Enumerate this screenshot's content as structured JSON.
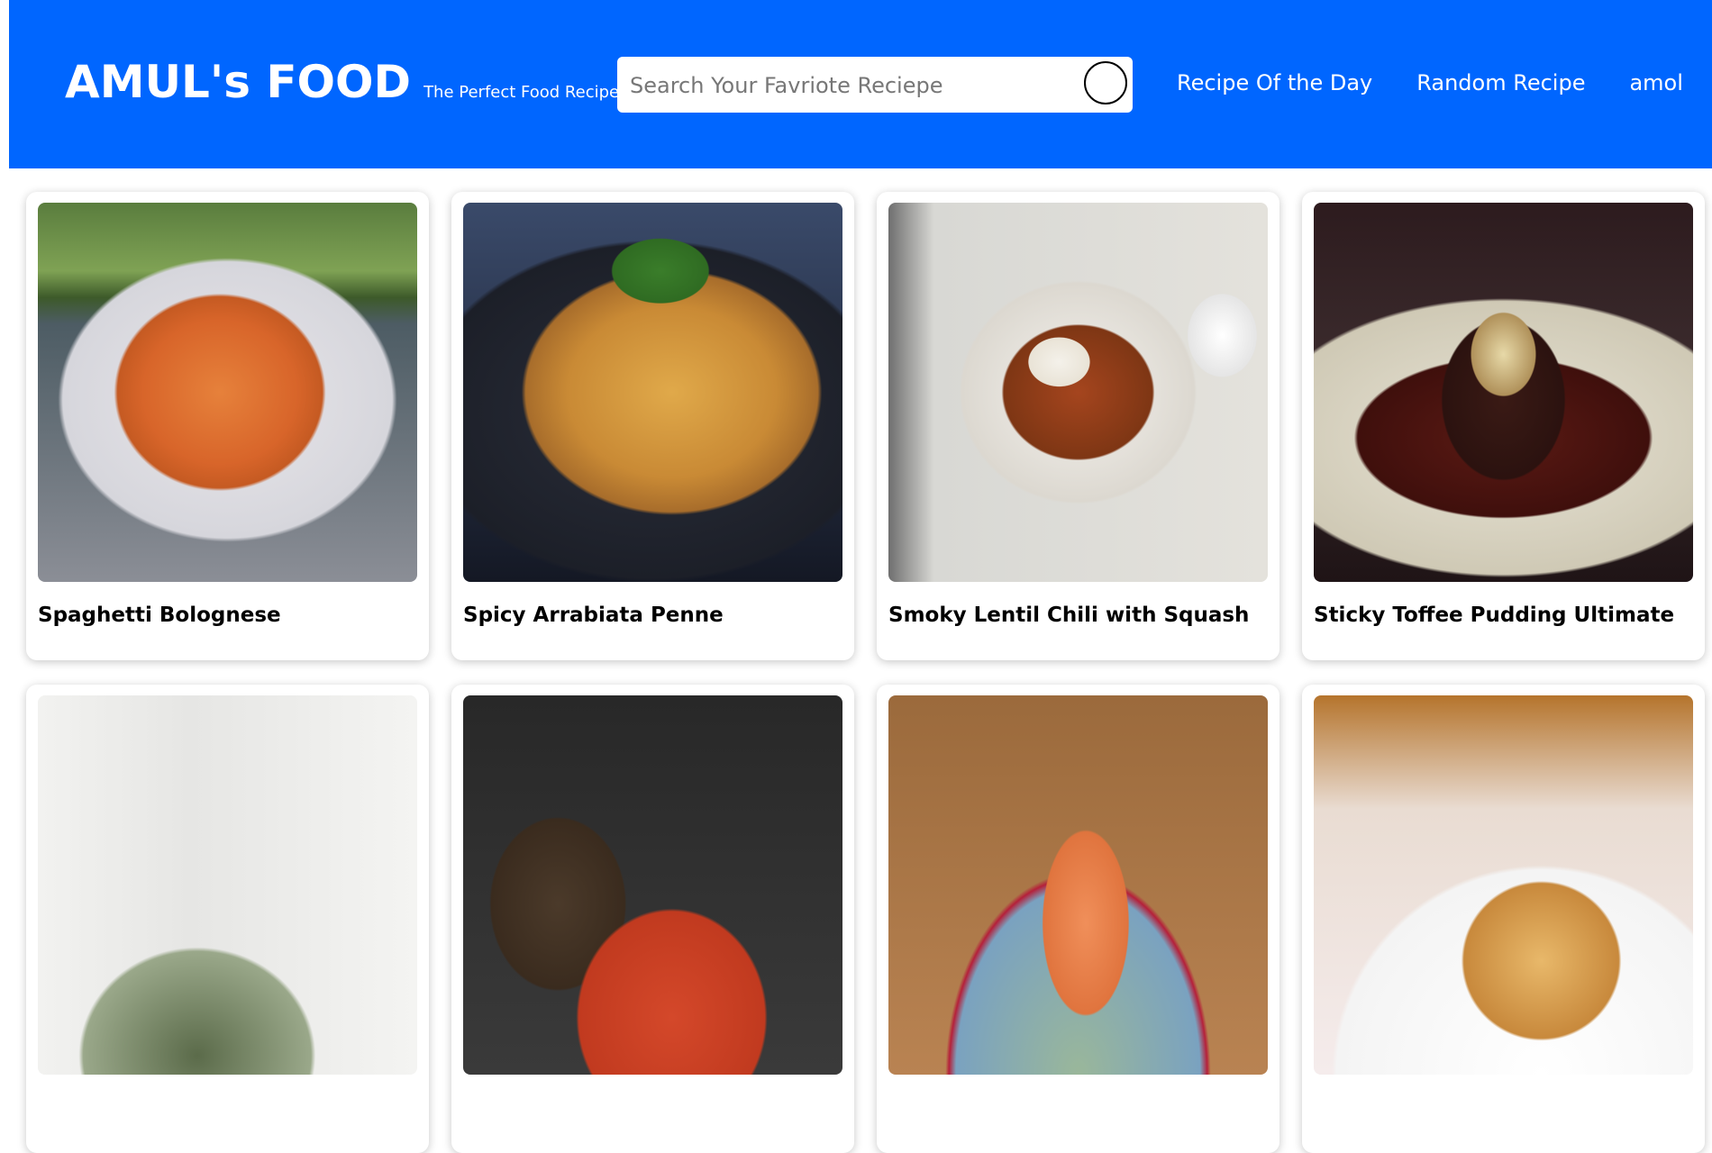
{
  "header": {
    "brand_title": "AMUL's FOOD",
    "brand_tagline": "The Perfect Food Recipes",
    "search_placeholder": "Search Your Favriote Reciepe",
    "nav": {
      "recipe_of_day": "Recipe Of the Day",
      "random_recipe": "Random Recipe",
      "user": "amol"
    },
    "background_color": "#0066ff"
  },
  "recipes": [
    {
      "title": "Spaghetti Bolognese"
    },
    {
      "title": "Spicy Arrabiata Penne"
    },
    {
      "title": "Smoky Lentil Chili with Squash"
    },
    {
      "title": "Sticky Toffee Pudding Ultimate"
    }
  ]
}
